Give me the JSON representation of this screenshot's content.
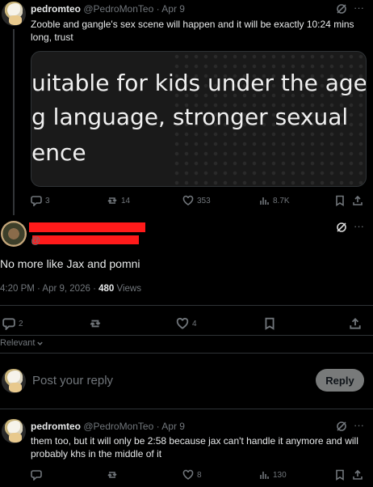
{
  "tweet1": {
    "name": "pedromteo",
    "handle": "@PedroMonTeo",
    "dot": "·",
    "date": "Apr 9",
    "text": "Zooble and gangle's sex scene will happen and it will be exactly 10:24 mins long, trust",
    "media_lines": [
      "uitable for kids under the age",
      "g language, stronger sexual",
      "ence"
    ],
    "actions": {
      "replies": "3",
      "reposts": "14",
      "likes": "353",
      "views": "8.7K"
    }
  },
  "main": {
    "text": "No more like Jax and pomni",
    "time": "4:20 PM · Apr 9, 2026 · ",
    "views_count": "480",
    "views_label": " Views",
    "actions": {
      "replies": "2",
      "likes": "4"
    },
    "relevant_label": "Relevant"
  },
  "composer": {
    "placeholder": "Post your reply",
    "reply_label": "Reply"
  },
  "tweet2": {
    "name": "pedromteo",
    "handle": "@PedroMonTeo",
    "dot": "·",
    "date": "Apr 9",
    "text": "them too, but it will only be 2:58 because jax can't handle it anymore and will probably khs in the middle of it",
    "actions": {
      "likes": "8",
      "views": "130"
    }
  },
  "colors": {
    "background": "#000000",
    "text": "#e7e9ea",
    "muted": "#71767b",
    "redaction": "#ff1a1a",
    "reply_button": "#787a7a"
  },
  "icons": [
    "reply-icon",
    "repost-icon",
    "like-icon",
    "views-icon",
    "bookmark-icon",
    "share-icon",
    "grok-icon",
    "more-icon",
    "chevron-down-icon"
  ]
}
